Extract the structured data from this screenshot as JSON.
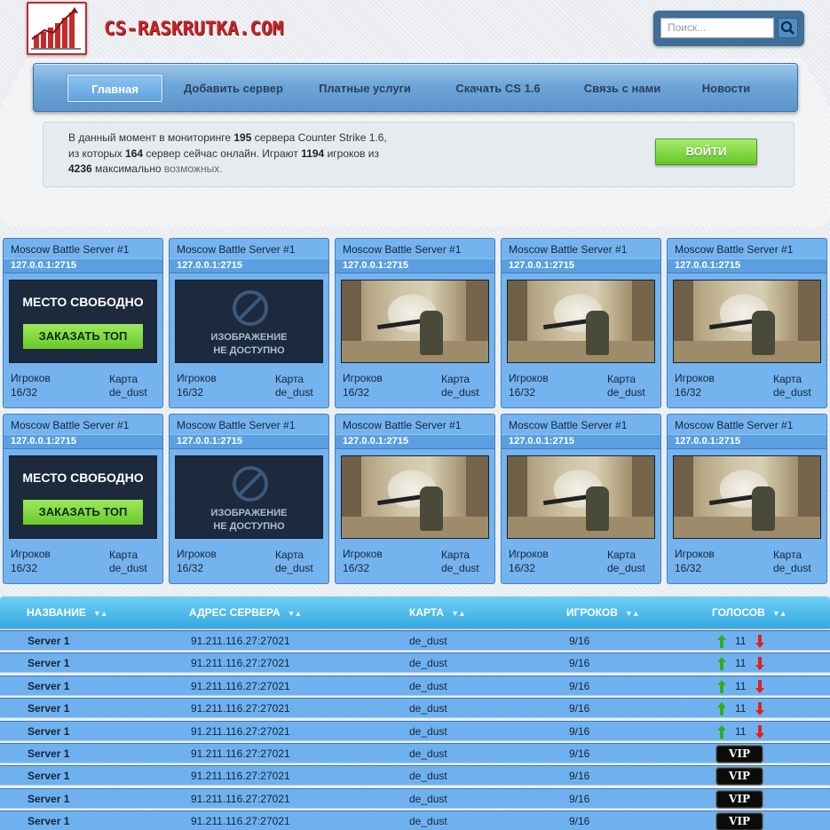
{
  "header": {
    "logo_text": "CS-RASKRUTKA.COM",
    "search_placeholder": "Поиск..."
  },
  "nav": {
    "items": [
      {
        "label": "Главная",
        "active": true
      },
      {
        "label": "Добавить сервер"
      },
      {
        "label": "Платные услуги"
      },
      {
        "label": "Скачать CS 1.6"
      },
      {
        "label": "Связь с нами"
      },
      {
        "label": "Новости"
      }
    ]
  },
  "info": {
    "t1": "В данный момент в мониторинге ",
    "servers_count": "195",
    "t2": " сервера Counter Strike 1.6, из которых ",
    "online_count": "164",
    "t3": " сервер сейчас онлайн. Играют ",
    "players": "1194",
    "t4": " игроков из ",
    "max_players": "4236",
    "t5": " максимально",
    "t6": " возможных."
  },
  "login_button": "ВОЙТИ",
  "card_labels": {
    "players": "Игроков",
    "map": "Карта",
    "free_slot": "МЕСТО СВОБОДНО",
    "order_top": "ЗАКАЗАТЬ ТОП",
    "na_line1": "ИЗОБРАЖЕНИЕ",
    "na_line2": "НЕ ДОСТУПНО"
  },
  "cards": [
    {
      "title": "Moscow Battle Server #1",
      "ip": "127.0.0.1:2715",
      "players": "16/32",
      "map": "de_dust",
      "image": "free"
    },
    {
      "title": "Moscow Battle Server #1",
      "ip": "127.0.0.1:2715",
      "players": "16/32",
      "map": "de_dust",
      "image": "na"
    },
    {
      "title": "Moscow Battle Server #1",
      "ip": "127.0.0.1:2715",
      "players": "16/32",
      "map": "de_dust",
      "image": "shot"
    },
    {
      "title": "Moscow Battle Server #1",
      "ip": "127.0.0.1:2715",
      "players": "16/32",
      "map": "de_dust",
      "image": "shot"
    },
    {
      "title": "Moscow Battle Server #1",
      "ip": "127.0.0.1:2715",
      "players": "16/32",
      "map": "de_dust",
      "image": "shot"
    },
    {
      "title": "Moscow Battle Server #1",
      "ip": "127.0.0.1:2715",
      "players": "16/32",
      "map": "de_dust",
      "image": "free"
    },
    {
      "title": "Moscow Battle Server #1",
      "ip": "127.0.0.1:2715",
      "players": "16/32",
      "map": "de_dust",
      "image": "na"
    },
    {
      "title": "Moscow Battle Server #1",
      "ip": "127.0.0.1:2715",
      "players": "16/32",
      "map": "de_dust",
      "image": "shot"
    },
    {
      "title": "Moscow Battle Server #1",
      "ip": "127.0.0.1:2715",
      "players": "16/32",
      "map": "de_dust",
      "image": "shot"
    },
    {
      "title": "Moscow Battle Server #1",
      "ip": "127.0.0.1:2715",
      "players": "16/32",
      "map": "de_dust",
      "image": "shot"
    }
  ],
  "table": {
    "columns": [
      "НАЗВАНИЕ",
      "АДРЕС СЕРВЕРА",
      "КАРТА",
      "ИГРОКОВ",
      "ГОЛОСОВ"
    ],
    "sort_glyph": "▼▲",
    "rows": [
      {
        "name": "Server 1",
        "address": "91.211.116.27:27021",
        "map": "de_dust",
        "players": "9/16",
        "votes": "11",
        "vip": false
      },
      {
        "name": "Server 1",
        "address": "91.211.116.27:27021",
        "map": "de_dust",
        "players": "9/16",
        "votes": "11",
        "vip": false
      },
      {
        "name": "Server 1",
        "address": "91.211.116.27:27021",
        "map": "de_dust",
        "players": "9/16",
        "votes": "11",
        "vip": false
      },
      {
        "name": "Server 1",
        "address": "91.211.116.27:27021",
        "map": "de_dust",
        "players": "9/16",
        "votes": "11",
        "vip": false
      },
      {
        "name": "Server 1",
        "address": "91.211.116.27:27021",
        "map": "de_dust",
        "players": "9/16",
        "votes": "11",
        "vip": false
      },
      {
        "name": "Server 1",
        "address": "91.211.116.27:27021",
        "map": "de_dust",
        "players": "9/16",
        "votes": "",
        "vip": true
      },
      {
        "name": "Server 1",
        "address": "91.211.116.27:27021",
        "map": "de_dust",
        "players": "9/16",
        "votes": "",
        "vip": true
      },
      {
        "name": "Server 1",
        "address": "91.211.116.27:27021",
        "map": "de_dust",
        "players": "9/16",
        "votes": "",
        "vip": true
      },
      {
        "name": "Server 1",
        "address": "91.211.116.27:27021",
        "map": "de_dust",
        "players": "9/16",
        "votes": "",
        "vip": true
      }
    ],
    "vip_label": "VIP"
  },
  "colors": {
    "brand_red": "#c1262a",
    "nav_blue": "#6ea6d8",
    "login_green": "#66c52a",
    "card_blue": "#74b3ee",
    "table_header": "#34a8e0",
    "vote_up": "#2fae1c",
    "vote_down": "#e02020"
  }
}
